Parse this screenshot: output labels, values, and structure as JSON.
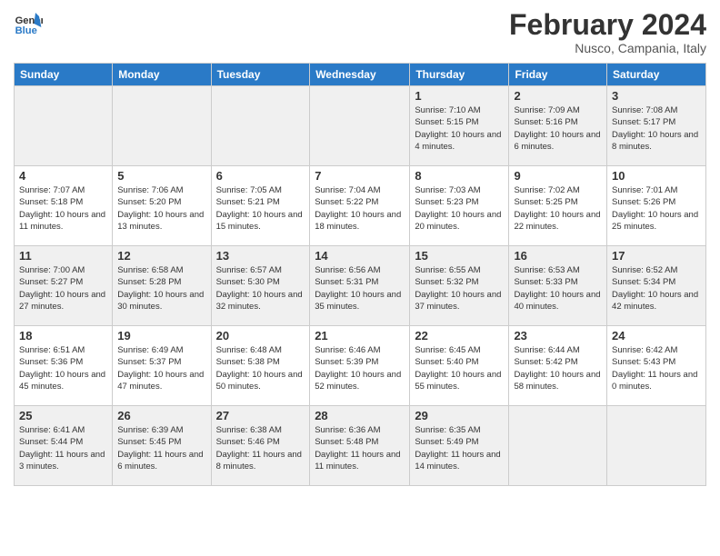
{
  "header": {
    "logo_line1": "General",
    "logo_line2": "Blue",
    "month": "February 2024",
    "location": "Nusco, Campania, Italy"
  },
  "weekdays": [
    "Sunday",
    "Monday",
    "Tuesday",
    "Wednesday",
    "Thursday",
    "Friday",
    "Saturday"
  ],
  "weeks": [
    [
      {
        "day": "",
        "info": ""
      },
      {
        "day": "",
        "info": ""
      },
      {
        "day": "",
        "info": ""
      },
      {
        "day": "",
        "info": ""
      },
      {
        "day": "1",
        "info": "Sunrise: 7:10 AM\nSunset: 5:15 PM\nDaylight: 10 hours\nand 4 minutes."
      },
      {
        "day": "2",
        "info": "Sunrise: 7:09 AM\nSunset: 5:16 PM\nDaylight: 10 hours\nand 6 minutes."
      },
      {
        "day": "3",
        "info": "Sunrise: 7:08 AM\nSunset: 5:17 PM\nDaylight: 10 hours\nand 8 minutes."
      }
    ],
    [
      {
        "day": "4",
        "info": "Sunrise: 7:07 AM\nSunset: 5:18 PM\nDaylight: 10 hours\nand 11 minutes."
      },
      {
        "day": "5",
        "info": "Sunrise: 7:06 AM\nSunset: 5:20 PM\nDaylight: 10 hours\nand 13 minutes."
      },
      {
        "day": "6",
        "info": "Sunrise: 7:05 AM\nSunset: 5:21 PM\nDaylight: 10 hours\nand 15 minutes."
      },
      {
        "day": "7",
        "info": "Sunrise: 7:04 AM\nSunset: 5:22 PM\nDaylight: 10 hours\nand 18 minutes."
      },
      {
        "day": "8",
        "info": "Sunrise: 7:03 AM\nSunset: 5:23 PM\nDaylight: 10 hours\nand 20 minutes."
      },
      {
        "day": "9",
        "info": "Sunrise: 7:02 AM\nSunset: 5:25 PM\nDaylight: 10 hours\nand 22 minutes."
      },
      {
        "day": "10",
        "info": "Sunrise: 7:01 AM\nSunset: 5:26 PM\nDaylight: 10 hours\nand 25 minutes."
      }
    ],
    [
      {
        "day": "11",
        "info": "Sunrise: 7:00 AM\nSunset: 5:27 PM\nDaylight: 10 hours\nand 27 minutes."
      },
      {
        "day": "12",
        "info": "Sunrise: 6:58 AM\nSunset: 5:28 PM\nDaylight: 10 hours\nand 30 minutes."
      },
      {
        "day": "13",
        "info": "Sunrise: 6:57 AM\nSunset: 5:30 PM\nDaylight: 10 hours\nand 32 minutes."
      },
      {
        "day": "14",
        "info": "Sunrise: 6:56 AM\nSunset: 5:31 PM\nDaylight: 10 hours\nand 35 minutes."
      },
      {
        "day": "15",
        "info": "Sunrise: 6:55 AM\nSunset: 5:32 PM\nDaylight: 10 hours\nand 37 minutes."
      },
      {
        "day": "16",
        "info": "Sunrise: 6:53 AM\nSunset: 5:33 PM\nDaylight: 10 hours\nand 40 minutes."
      },
      {
        "day": "17",
        "info": "Sunrise: 6:52 AM\nSunset: 5:34 PM\nDaylight: 10 hours\nand 42 minutes."
      }
    ],
    [
      {
        "day": "18",
        "info": "Sunrise: 6:51 AM\nSunset: 5:36 PM\nDaylight: 10 hours\nand 45 minutes."
      },
      {
        "day": "19",
        "info": "Sunrise: 6:49 AM\nSunset: 5:37 PM\nDaylight: 10 hours\nand 47 minutes."
      },
      {
        "day": "20",
        "info": "Sunrise: 6:48 AM\nSunset: 5:38 PM\nDaylight: 10 hours\nand 50 minutes."
      },
      {
        "day": "21",
        "info": "Sunrise: 6:46 AM\nSunset: 5:39 PM\nDaylight: 10 hours\nand 52 minutes."
      },
      {
        "day": "22",
        "info": "Sunrise: 6:45 AM\nSunset: 5:40 PM\nDaylight: 10 hours\nand 55 minutes."
      },
      {
        "day": "23",
        "info": "Sunrise: 6:44 AM\nSunset: 5:42 PM\nDaylight: 10 hours\nand 58 minutes."
      },
      {
        "day": "24",
        "info": "Sunrise: 6:42 AM\nSunset: 5:43 PM\nDaylight: 11 hours\nand 0 minutes."
      }
    ],
    [
      {
        "day": "25",
        "info": "Sunrise: 6:41 AM\nSunset: 5:44 PM\nDaylight: 11 hours\nand 3 minutes."
      },
      {
        "day": "26",
        "info": "Sunrise: 6:39 AM\nSunset: 5:45 PM\nDaylight: 11 hours\nand 6 minutes."
      },
      {
        "day": "27",
        "info": "Sunrise: 6:38 AM\nSunset: 5:46 PM\nDaylight: 11 hours\nand 8 minutes."
      },
      {
        "day": "28",
        "info": "Sunrise: 6:36 AM\nSunset: 5:48 PM\nDaylight: 11 hours\nand 11 minutes."
      },
      {
        "day": "29",
        "info": "Sunrise: 6:35 AM\nSunset: 5:49 PM\nDaylight: 11 hours\nand 14 minutes."
      },
      {
        "day": "",
        "info": ""
      },
      {
        "day": "",
        "info": ""
      }
    ]
  ]
}
